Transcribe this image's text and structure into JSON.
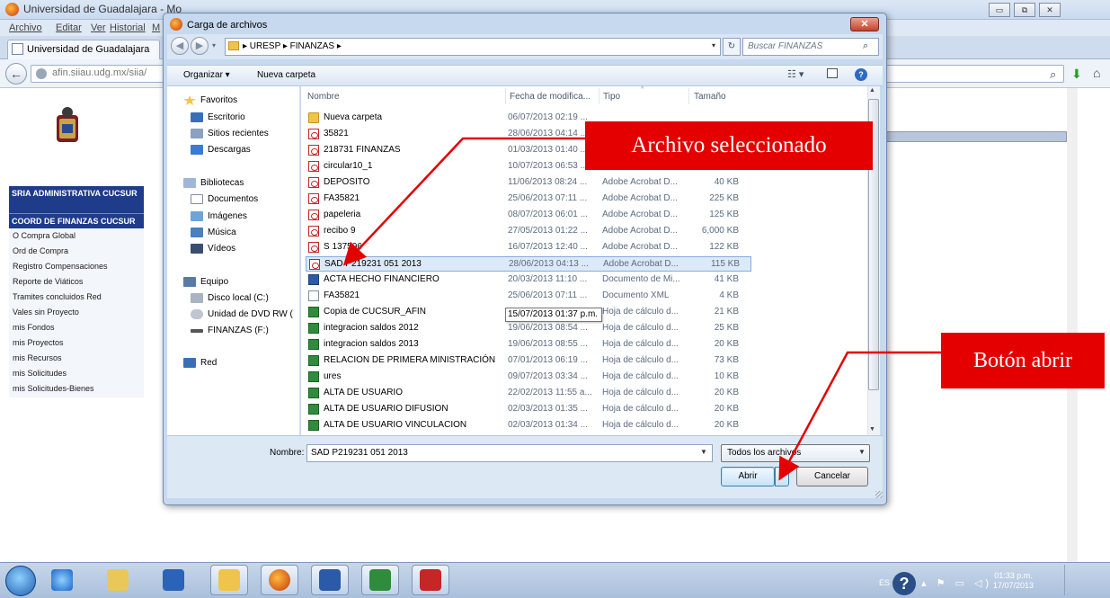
{
  "browser": {
    "title": "Universidad de Guadalajara - Mo",
    "menu": [
      "Archivo",
      "Editar",
      "Ver",
      "Historial",
      "M"
    ],
    "tab_label": "Universidad de Guadalajara",
    "url": "afin.siiau.udg.mx/siia/",
    "win_controls": [
      "▭",
      "⧉",
      "✕"
    ],
    "sidebar": {
      "header1": "SRIA ADMINISTRATIVA CUCSUR",
      "header2": "COORD DE FINANZAS CUCSUR",
      "items": [
        "O Compra Global",
        "Ord de Compra",
        "Registro Compensaciones",
        "Reporte de Viáticos",
        "Tramites concluidos Red",
        "Vales sin Proyecto",
        "mis Fondos",
        "mis Proyectos",
        "mis Recursos",
        "mis Solicitudes",
        "mis Solicitudes-Bienes"
      ]
    }
  },
  "dialog": {
    "title": "Carga de archivos",
    "close_label": "✕",
    "path": "▸ URESP ▸ FINANZAS ▸",
    "search_placeholder": "Buscar FINANZAS",
    "toolbar": {
      "organizar": "Organizar ▾",
      "nueva_carpeta": "Nueva carpeta"
    },
    "nav": {
      "favoritos": "Favoritos",
      "escritorio": "Escritorio",
      "sitios": "Sitios recientes",
      "descargas": "Descargas",
      "bibliotecas": "Bibliotecas",
      "documentos": "Documentos",
      "imagenes": "Imágenes",
      "musica": "Música",
      "videos": "Vídeos",
      "equipo": "Equipo",
      "disco": "Disco local (C:)",
      "dvd": "Unidad de DVD RW (",
      "finanzas": "FINANZAS (F:)",
      "red": "Red"
    },
    "columns": {
      "nombre": "Nombre",
      "fecha": "Fecha de modifica...",
      "tipo": "Tipo",
      "tamano": "Tamaño"
    },
    "files": [
      {
        "name": "Nueva carpeta",
        "date": "06/07/2013 02:19 ...",
        "type": "",
        "size": "",
        "icon": "folder"
      },
      {
        "name": "35821",
        "date": "28/06/2013 04:14 ...",
        "type": "",
        "size": "",
        "icon": "pdf"
      },
      {
        "name": "218731 FINANZAS",
        "date": "01/03/2013 01:40 ...",
        "type": "",
        "size": "",
        "icon": "pdf"
      },
      {
        "name": "circular10_1",
        "date": "10/07/2013 06:53 ...",
        "type": "",
        "size": "",
        "icon": "pdf"
      },
      {
        "name": "DEPOSITO",
        "date": "11/06/2013 08:24 ...",
        "type": "Adobe Acrobat D...",
        "size": "40 KB",
        "icon": "pdf"
      },
      {
        "name": "FA35821",
        "date": "25/06/2013 07:11 ...",
        "type": "Adobe Acrobat D...",
        "size": "225 KB",
        "icon": "pdf"
      },
      {
        "name": "papeleria",
        "date": "08/07/2013 06:01 ...",
        "type": "Adobe Acrobat D...",
        "size": "125 KB",
        "icon": "pdf"
      },
      {
        "name": "recibo 9",
        "date": "27/05/2013 01:22 ...",
        "type": "Adobe Acrobat D...",
        "size": "6,000 KB",
        "icon": "pdf"
      },
      {
        "name": "S 137596",
        "date": "16/07/2013 12:40 ...",
        "type": "Adobe Acrobat D...",
        "size": "122 KB",
        "icon": "pdf"
      },
      {
        "name": "SAD P219231 051 2013",
        "date": "28/06/2013 04:13 ...",
        "type": "Adobe Acrobat D...",
        "size": "115 KB",
        "icon": "pdf",
        "selected": true
      },
      {
        "name": "ACTA HECHO FINANCIERO",
        "date": "20/03/2013 11:10 ...",
        "type": "Documento de Mi...",
        "size": "41 KB",
        "icon": "word"
      },
      {
        "name": "FA35821",
        "date": "25/06/2013 07:11 ...",
        "type": "Documento XML",
        "size": "4 KB",
        "icon": "xml"
      },
      {
        "name": "Copia de CUCSUR_AFIN",
        "date": "",
        "type": "Hoja de cálculo d...",
        "size": "21 KB",
        "icon": "xls"
      },
      {
        "name": "integracion saldos 2012",
        "date": "19/06/2013 08:54 ...",
        "type": "Hoja de cálculo d...",
        "size": "25 KB",
        "icon": "xls"
      },
      {
        "name": "integracion saldos 2013",
        "date": "19/06/2013 08:55 ...",
        "type": "Hoja de cálculo d...",
        "size": "20 KB",
        "icon": "xls"
      },
      {
        "name": "RELACION DE PRIMERA MINISTRACIÓN",
        "date": "07/01/2013 06:19 ...",
        "type": "Hoja de cálculo d...",
        "size": "73 KB",
        "icon": "xls"
      },
      {
        "name": "ures",
        "date": "09/07/2013 03:34 ...",
        "type": "Hoja de cálculo d...",
        "size": "10 KB",
        "icon": "xls"
      },
      {
        "name": "ALTA DE USUARIO",
        "date": "22/02/2013 11:55 a...",
        "type": "Hoja de cálculo d...",
        "size": "20 KB",
        "icon": "xls"
      },
      {
        "name": "ALTA DE USUARIO DIFUSION",
        "date": "02/03/2013 01:35 ...",
        "type": "Hoja de cálculo d...",
        "size": "20 KB",
        "icon": "xls"
      },
      {
        "name": "ALTA DE USUARIO VINCULACION",
        "date": "02/03/2013 01:34 ...",
        "type": "Hoja de cálculo d...",
        "size": "20 KB",
        "icon": "xls"
      }
    ],
    "tooltip": "15/07/2013 01:37 p.m.",
    "filename_label": "Nombre:",
    "filename_value": "SAD P219231 051 2013",
    "filetype": "Todos los archivos",
    "open_label": "Abrir",
    "cancel_label": "Cancelar"
  },
  "annotations": {
    "archivo": "Archivo seleccionado",
    "abrir": "Botón abrir",
    "color": "#e50000"
  },
  "taskbar": {
    "lang": "ES",
    "time": "01:33 p.m.",
    "date": "17/07/2013"
  }
}
